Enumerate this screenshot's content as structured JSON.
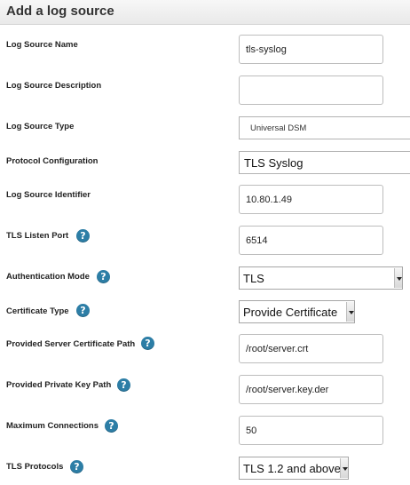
{
  "header": {
    "title": "Add a log source"
  },
  "fields": {
    "name": {
      "label": "Log Source Name",
      "value": "tls-syslog"
    },
    "description": {
      "label": "Log Source Description",
      "value": ""
    },
    "type": {
      "label": "Log Source Type",
      "value": "Universal DSM"
    },
    "protocol": {
      "label": "Protocol Configuration",
      "value": "TLS Syslog"
    },
    "identifier": {
      "label": "Log Source Identifier",
      "value": "10.80.1.49"
    },
    "listen_port": {
      "label": "TLS Listen Port",
      "value": "6514"
    },
    "auth_mode": {
      "label": "Authentication Mode",
      "value": "TLS"
    },
    "cert_type": {
      "label": "Certificate Type",
      "value": "Provide Certificate"
    },
    "server_cert_path": {
      "label": "Provided Server Certificate Path",
      "value": "/root/server.crt"
    },
    "private_key_path": {
      "label": "Provided Private Key Path",
      "value": "/root/server.key.der"
    },
    "max_connections": {
      "label": "Maximum Connections",
      "value": "50"
    },
    "tls_protocols": {
      "label": "TLS Protocols",
      "value": "TLS 1.2 and above"
    }
  },
  "help_glyph": "?",
  "colors": {
    "help_icon": "#2d7ea6",
    "header_bg": "#ececec"
  }
}
